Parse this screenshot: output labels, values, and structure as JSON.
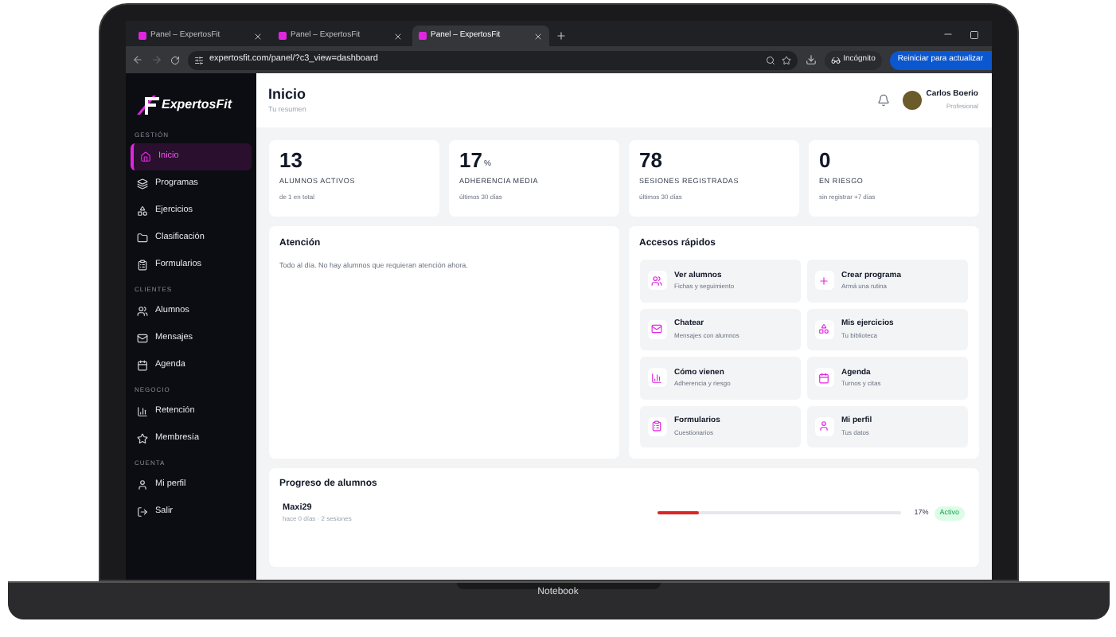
{
  "browser": {
    "tabs": [
      {
        "label": "Panel – ExpertosFit",
        "selected": false
      },
      {
        "label": "Panel – ExpertosFit",
        "selected": false
      },
      {
        "label": "Panel – ExpertosFit",
        "selected": true
      }
    ],
    "url": "expertosfit.com/panel/?c3_view=dashboard",
    "incognito": "Incógnito",
    "restart_button": "Reiniciar para actualizar"
  },
  "sidebar": {
    "logo": "ExpertosFit",
    "sections": [
      {
        "title": "GESTIÓN",
        "items": [
          {
            "label": "Inicio",
            "selected": true
          },
          {
            "label": "Programas",
            "selected": false
          },
          {
            "label": "Ejercicios",
            "selected": false
          },
          {
            "label": "Clasificación",
            "selected": false
          },
          {
            "label": "Formularios",
            "selected": false
          }
        ]
      },
      {
        "title": "CLIENTES",
        "items": [
          {
            "label": "Alumnos",
            "selected": false
          },
          {
            "label": "Mensajes",
            "selected": false
          },
          {
            "label": "Agenda",
            "selected": false
          }
        ]
      },
      {
        "title": "NEGOCIO",
        "items": [
          {
            "label": "Retención",
            "selected": false
          },
          {
            "label": "Membresía",
            "selected": false
          }
        ]
      },
      {
        "title": "CUENTA",
        "items": [
          {
            "label": "Mi perfil",
            "selected": false
          },
          {
            "label": "Salir",
            "selected": false
          }
        ]
      }
    ]
  },
  "header": {
    "title": "Inicio",
    "subtitle": "Tu resumen",
    "user_name": "Carlos Boerio",
    "user_role": "Profesional"
  },
  "stats": [
    {
      "value": "13",
      "label": "ALUMNOS ACTIVOS",
      "note": "de 1 en total"
    },
    {
      "value": "17",
      "unit": "%",
      "label": "ADHERENCIA MEDIA",
      "note": "últimos 30 días"
    },
    {
      "value": "78",
      "label": "SESIONES REGISTRADAS",
      "note": "últimos 30 días"
    },
    {
      "value": "0",
      "label": "EN RIESGO",
      "note": "sin registrar +7 días"
    }
  ],
  "attention": {
    "title": "Atención",
    "text": "Todo al día. No hay alumnos que requieran atención ahora."
  },
  "quick_access": {
    "title": "Accesos rápidos",
    "items": [
      {
        "title": "Ver alumnos",
        "subtitle": "Fichas y seguimiento"
      },
      {
        "title": "Crear programa",
        "subtitle": "Armá una rutina"
      },
      {
        "title": "Chatear",
        "subtitle": "Mensajes con alumnos"
      },
      {
        "title": "Mis ejercicios",
        "subtitle": "Tu biblioteca"
      },
      {
        "title": "Cómo vienen",
        "subtitle": "Adherencia y riesgo"
      },
      {
        "title": "Agenda",
        "subtitle": "Turnos y citas"
      },
      {
        "title": "Formularios",
        "subtitle": "Cuestionarios"
      },
      {
        "title": "Mi perfil",
        "subtitle": "Tus datos"
      }
    ]
  },
  "progress": {
    "title": "Progreso de alumnos",
    "rows": [
      {
        "name": "Maxi29",
        "meta": "hace 0 días · 2 sesiones",
        "level": 0.17,
        "percent": "17%",
        "status": "Activo",
        "color": "#dc2626"
      }
    ]
  },
  "laptop_label": "Notebook"
}
